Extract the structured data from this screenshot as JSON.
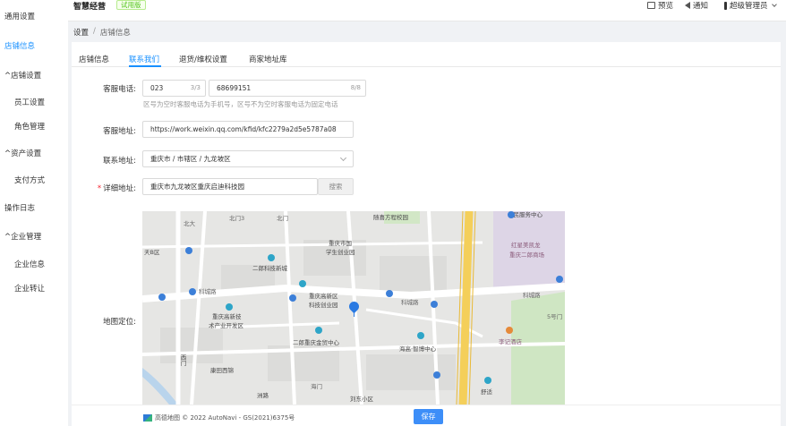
{
  "sidebar": {
    "items": [
      {
        "label": "通用设置"
      },
      {
        "label": "店铺信息"
      },
      {
        "label": "店铺设置"
      },
      {
        "label": "员工设置"
      },
      {
        "label": "角色管理"
      },
      {
        "label": "资产设置"
      },
      {
        "label": "支付方式"
      },
      {
        "label": "操作日志"
      },
      {
        "label": "企业管理"
      },
      {
        "label": "企业信息"
      },
      {
        "label": "企业转让"
      }
    ],
    "expand_glyph": "^"
  },
  "header": {
    "brand": "智慧经营",
    "trial_badge": "试用版",
    "preview": "预览",
    "notify": "通知",
    "user": "超级管理员"
  },
  "breadcrumb": {
    "root": "设置",
    "sep": "/",
    "current": "店铺信息"
  },
  "tabs": [
    {
      "label": "店铺信息"
    },
    {
      "label": "联系我们"
    },
    {
      "label": "退货/维权设置"
    },
    {
      "label": "商家地址库"
    }
  ],
  "form": {
    "phone": {
      "label": "客服电话:",
      "area_code": "023",
      "area_count": "3/3",
      "number": "68699151",
      "number_count": "8/8",
      "hint": "区号为空时客服电话为手机号，区号不为空时客服电话为固定电话"
    },
    "address_url": {
      "label": "客服地址:",
      "value": "https://work.weixin.qq.com/kfid/kfc2279a2d5e5787a08"
    },
    "region": {
      "label": "联系地址:",
      "value": "重庆市 / 市辖区 / 九龙坡区"
    },
    "detail": {
      "required": "*",
      "label": "详细地址:",
      "value": "重庆市九龙坡区重庆启迪科技园",
      "search": "搜索"
    },
    "map": {
      "label": "地图定位:"
    }
  },
  "map": {
    "labels": {
      "beimen3": "北门3",
      "beimen": "北门",
      "suixin": "随喜方程校园",
      "xingjiayuan": "便民服务中心",
      "beida": "北大",
      "tianyiqu": "天B区",
      "chongqingshi": "重庆市国",
      "xuesheng": "学生创业园",
      "hongxing": "红星美凯龙",
      "chongqing2": "重庆二郎商场",
      "erlang": "二郎科技新城",
      "kechenglu": "科城路",
      "gaoxin": "重庆高新区",
      "chuangyeyuan": "科技创业园",
      "kechenglu2": "科城路",
      "kechenglu3": "科城路",
      "gaoxin2": "重庆高新技",
      "chanye": "术产业开发区",
      "shangmao": "二郎重庆金贸中心",
      "haizhi": "海高·智博中心",
      "jiluchongqing": "李记酒店",
      "kangtian": "康田西锦",
      "beimen5": "5号门",
      "xixi": "西门",
      "menji": "海门",
      "shuzhu": "洲路",
      "dianxi": "刘东小区",
      "shuyuan": "舒适",
      "juda": "聚大"
    }
  },
  "footer": {
    "attribution": "高德地图 © 2022 AutoNavi - GS(2021)6375号",
    "save": "保存"
  }
}
